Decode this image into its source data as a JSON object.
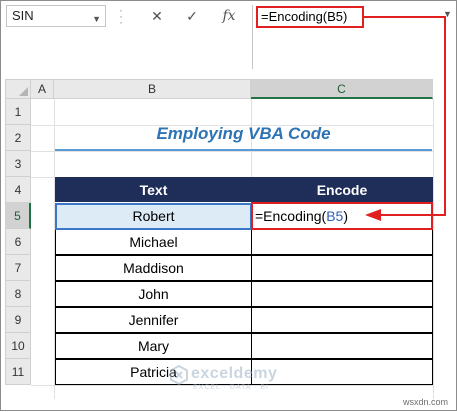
{
  "formula_bar": {
    "name_box": "SIN",
    "cancel_symbol": "✕",
    "enter_symbol": "✓",
    "fx_label": "fx",
    "formula": "=Encoding(B5)"
  },
  "columns": [
    "A",
    "B",
    "C"
  ],
  "active_column": "C",
  "rows": [
    "1",
    "2",
    "3",
    "4",
    "5",
    "6",
    "7",
    "8",
    "9",
    "10",
    "11"
  ],
  "active_row": "5",
  "sheet": {
    "title": "Employing VBA Code",
    "headers": {
      "text": "Text",
      "encode": "Encode"
    },
    "names": [
      "Robert",
      "Michael",
      "Maddison",
      "John",
      "Jennifer",
      "Mary",
      "Patricia"
    ],
    "edit_cell": {
      "prefix": "=Encoding(",
      "ref": "B5",
      "suffix": ")"
    }
  },
  "watermark": {
    "brand": "exceldemy",
    "tagline": "EXCEL · DATA · BI"
  },
  "site": "wsxdn.com",
  "colors": {
    "header_fill": "#1f2d59",
    "title": "#2e74b5",
    "highlight": "#e02020",
    "selected_fill": "#ddebf7"
  }
}
